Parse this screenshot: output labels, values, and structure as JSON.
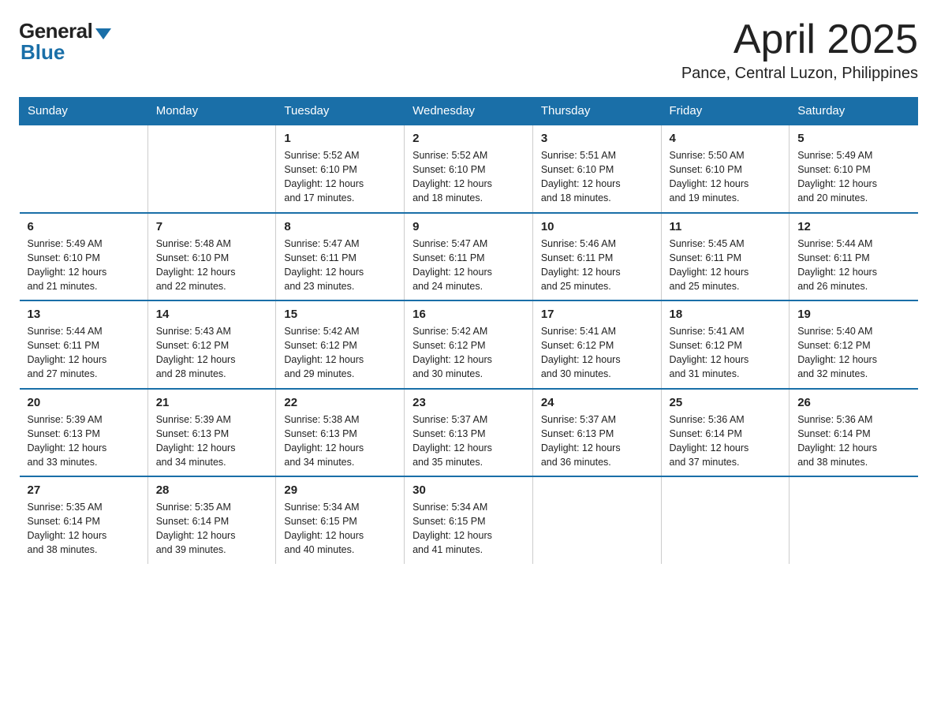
{
  "logo": {
    "general": "General",
    "blue": "Blue"
  },
  "header": {
    "month": "April 2025",
    "location": "Pance, Central Luzon, Philippines"
  },
  "weekdays": [
    "Sunday",
    "Monday",
    "Tuesday",
    "Wednesday",
    "Thursday",
    "Friday",
    "Saturday"
  ],
  "weeks": [
    [
      {
        "day": "",
        "info": ""
      },
      {
        "day": "",
        "info": ""
      },
      {
        "day": "1",
        "info": "Sunrise: 5:52 AM\nSunset: 6:10 PM\nDaylight: 12 hours\nand 17 minutes."
      },
      {
        "day": "2",
        "info": "Sunrise: 5:52 AM\nSunset: 6:10 PM\nDaylight: 12 hours\nand 18 minutes."
      },
      {
        "day": "3",
        "info": "Sunrise: 5:51 AM\nSunset: 6:10 PM\nDaylight: 12 hours\nand 18 minutes."
      },
      {
        "day": "4",
        "info": "Sunrise: 5:50 AM\nSunset: 6:10 PM\nDaylight: 12 hours\nand 19 minutes."
      },
      {
        "day": "5",
        "info": "Sunrise: 5:49 AM\nSunset: 6:10 PM\nDaylight: 12 hours\nand 20 minutes."
      }
    ],
    [
      {
        "day": "6",
        "info": "Sunrise: 5:49 AM\nSunset: 6:10 PM\nDaylight: 12 hours\nand 21 minutes."
      },
      {
        "day": "7",
        "info": "Sunrise: 5:48 AM\nSunset: 6:10 PM\nDaylight: 12 hours\nand 22 minutes."
      },
      {
        "day": "8",
        "info": "Sunrise: 5:47 AM\nSunset: 6:11 PM\nDaylight: 12 hours\nand 23 minutes."
      },
      {
        "day": "9",
        "info": "Sunrise: 5:47 AM\nSunset: 6:11 PM\nDaylight: 12 hours\nand 24 minutes."
      },
      {
        "day": "10",
        "info": "Sunrise: 5:46 AM\nSunset: 6:11 PM\nDaylight: 12 hours\nand 25 minutes."
      },
      {
        "day": "11",
        "info": "Sunrise: 5:45 AM\nSunset: 6:11 PM\nDaylight: 12 hours\nand 25 minutes."
      },
      {
        "day": "12",
        "info": "Sunrise: 5:44 AM\nSunset: 6:11 PM\nDaylight: 12 hours\nand 26 minutes."
      }
    ],
    [
      {
        "day": "13",
        "info": "Sunrise: 5:44 AM\nSunset: 6:11 PM\nDaylight: 12 hours\nand 27 minutes."
      },
      {
        "day": "14",
        "info": "Sunrise: 5:43 AM\nSunset: 6:12 PM\nDaylight: 12 hours\nand 28 minutes."
      },
      {
        "day": "15",
        "info": "Sunrise: 5:42 AM\nSunset: 6:12 PM\nDaylight: 12 hours\nand 29 minutes."
      },
      {
        "day": "16",
        "info": "Sunrise: 5:42 AM\nSunset: 6:12 PM\nDaylight: 12 hours\nand 30 minutes."
      },
      {
        "day": "17",
        "info": "Sunrise: 5:41 AM\nSunset: 6:12 PM\nDaylight: 12 hours\nand 30 minutes."
      },
      {
        "day": "18",
        "info": "Sunrise: 5:41 AM\nSunset: 6:12 PM\nDaylight: 12 hours\nand 31 minutes."
      },
      {
        "day": "19",
        "info": "Sunrise: 5:40 AM\nSunset: 6:12 PM\nDaylight: 12 hours\nand 32 minutes."
      }
    ],
    [
      {
        "day": "20",
        "info": "Sunrise: 5:39 AM\nSunset: 6:13 PM\nDaylight: 12 hours\nand 33 minutes."
      },
      {
        "day": "21",
        "info": "Sunrise: 5:39 AM\nSunset: 6:13 PM\nDaylight: 12 hours\nand 34 minutes."
      },
      {
        "day": "22",
        "info": "Sunrise: 5:38 AM\nSunset: 6:13 PM\nDaylight: 12 hours\nand 34 minutes."
      },
      {
        "day": "23",
        "info": "Sunrise: 5:37 AM\nSunset: 6:13 PM\nDaylight: 12 hours\nand 35 minutes."
      },
      {
        "day": "24",
        "info": "Sunrise: 5:37 AM\nSunset: 6:13 PM\nDaylight: 12 hours\nand 36 minutes."
      },
      {
        "day": "25",
        "info": "Sunrise: 5:36 AM\nSunset: 6:14 PM\nDaylight: 12 hours\nand 37 minutes."
      },
      {
        "day": "26",
        "info": "Sunrise: 5:36 AM\nSunset: 6:14 PM\nDaylight: 12 hours\nand 38 minutes."
      }
    ],
    [
      {
        "day": "27",
        "info": "Sunrise: 5:35 AM\nSunset: 6:14 PM\nDaylight: 12 hours\nand 38 minutes."
      },
      {
        "day": "28",
        "info": "Sunrise: 5:35 AM\nSunset: 6:14 PM\nDaylight: 12 hours\nand 39 minutes."
      },
      {
        "day": "29",
        "info": "Sunrise: 5:34 AM\nSunset: 6:15 PM\nDaylight: 12 hours\nand 40 minutes."
      },
      {
        "day": "30",
        "info": "Sunrise: 5:34 AM\nSunset: 6:15 PM\nDaylight: 12 hours\nand 41 minutes."
      },
      {
        "day": "",
        "info": ""
      },
      {
        "day": "",
        "info": ""
      },
      {
        "day": "",
        "info": ""
      }
    ]
  ]
}
